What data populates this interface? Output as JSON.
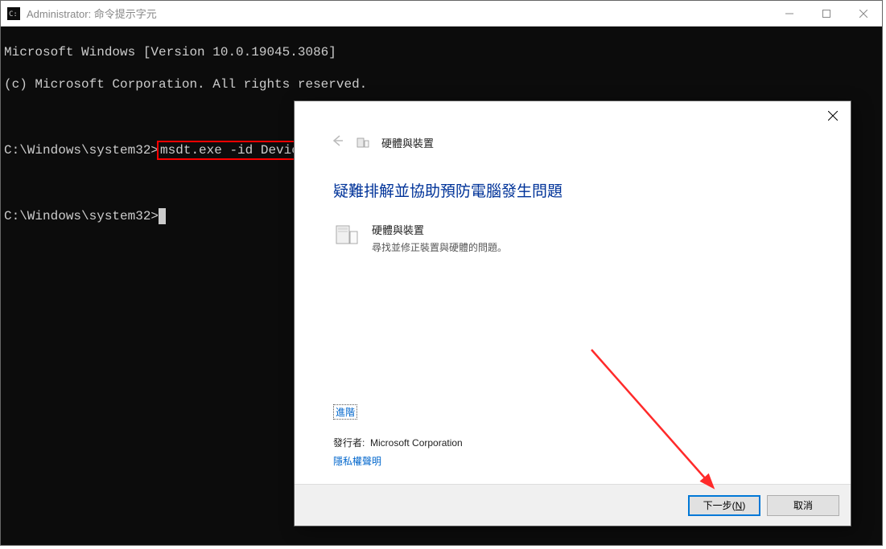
{
  "cmd": {
    "title": "Administrator: 命令提示字元",
    "lines": {
      "l1": "Microsoft Windows [Version 10.0.19045.3086]",
      "l2": "(c) Microsoft Corporation. All rights reserved.",
      "prompt1_path": "C:\\Windows\\system32>",
      "prompt1_cmd": "msdt.exe -id DeviceDiagnostic",
      "prompt2_path": "C:\\Windows\\system32>"
    },
    "icons": {
      "app": "cmd-icon",
      "min": "minimize",
      "max": "maximize",
      "close": "close"
    }
  },
  "dialog": {
    "header_title": "硬體與裝置",
    "heading": "疑難排解並協助預防電腦發生問題",
    "item_title": "硬體與裝置",
    "item_desc": "尋找並修正裝置與硬體的問題。",
    "advanced": "進階",
    "publisher_label": "發行者:",
    "publisher_value": "Microsoft Corporation",
    "privacy": "隱私權聲明",
    "next": "下一步(N)",
    "next_key": "N",
    "cancel": "取消"
  },
  "annotation": {
    "arrow_color": "#ff2a2a"
  }
}
